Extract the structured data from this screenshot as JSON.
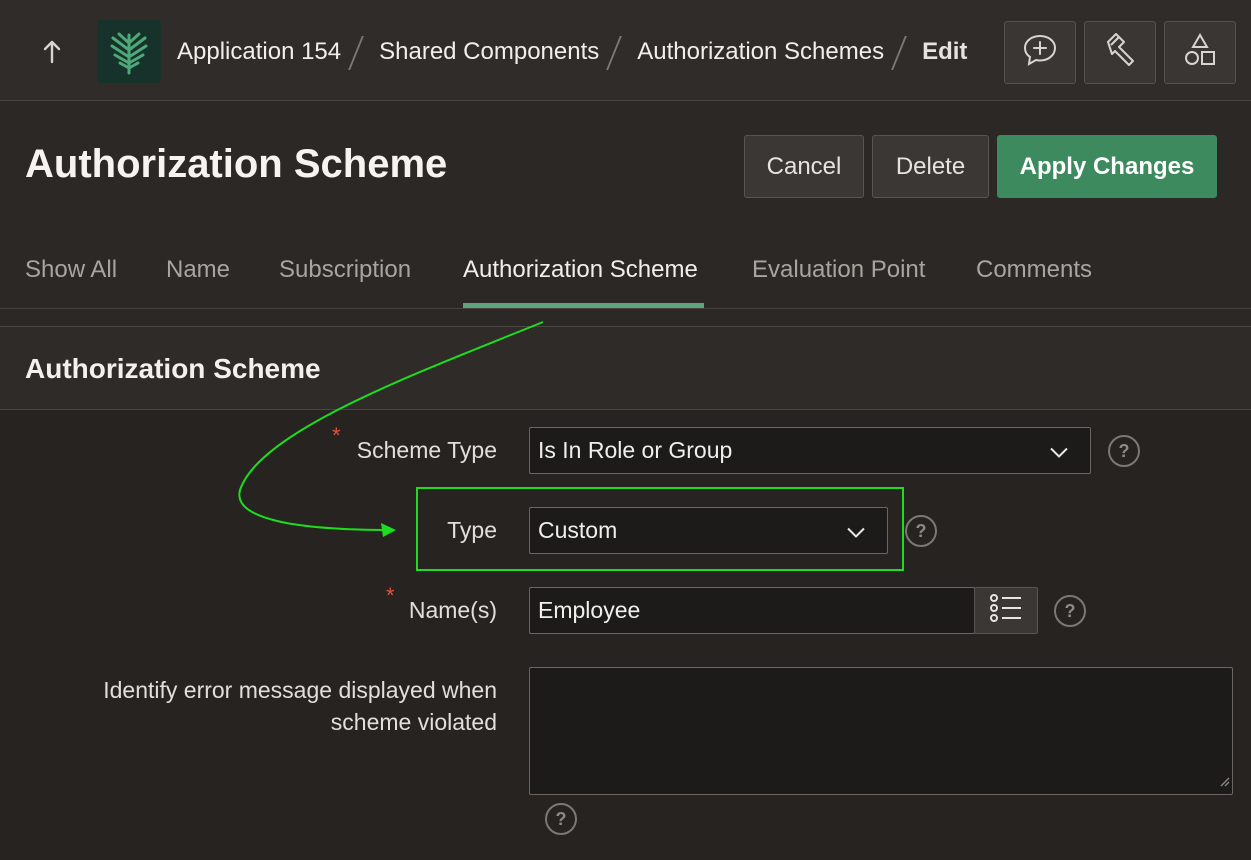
{
  "header": {
    "breadcrumb": [
      "Application 154",
      "Shared Components",
      "Authorization Schemes"
    ],
    "breadcrumb_current": "Edit",
    "icons": [
      "up-arrow-icon",
      "app-tree-logo-icon",
      "feedback-plus-icon",
      "flashlight-icon",
      "shapes-icon"
    ]
  },
  "page": {
    "title": "Authorization Scheme",
    "cancel_label": "Cancel",
    "delete_label": "Delete",
    "apply_label": "Apply Changes"
  },
  "tabs": [
    {
      "label": "Show All",
      "active": false
    },
    {
      "label": "Name",
      "active": false
    },
    {
      "label": "Subscription",
      "active": false
    },
    {
      "label": "Authorization Scheme",
      "active": true
    },
    {
      "label": "Evaluation Point",
      "active": false
    },
    {
      "label": "Comments",
      "active": false
    }
  ],
  "region": {
    "title": "Authorization Scheme",
    "fields": {
      "scheme_type": {
        "label": "Scheme Type",
        "required": true,
        "value": "Is In Role or Group"
      },
      "type": {
        "label": "Type",
        "required": false,
        "value": "Custom"
      },
      "names": {
        "label": "Name(s)",
        "required": true,
        "value": "Employee"
      },
      "error_message": {
        "label_line1": "Identify error message displayed when",
        "label_line2": "scheme violated",
        "value": ""
      }
    },
    "required_marker": "*",
    "help_glyph": "?"
  },
  "colors": {
    "primary_button": "#3d8a5e",
    "active_tab_underline": "#5fa37a",
    "annotation_green": "#1edc1e",
    "required_red": "#e0533f"
  }
}
